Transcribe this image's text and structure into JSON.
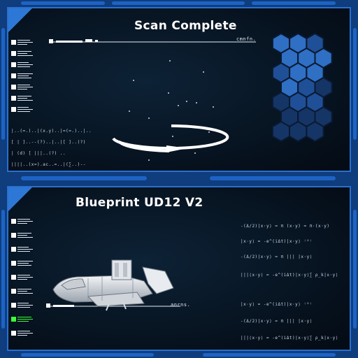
{
  "colors": {
    "frame": "#0f3d7d",
    "frame_bar": "#1e63c4",
    "panel_border": "#2a6fcc",
    "hex_bright": "#2f6fc4",
    "hex_mid": "#1f4f96",
    "hex_dim": "#153566",
    "active_item": "#3bff3b"
  },
  "scan_panel": {
    "title": "Scan Complete",
    "scale_label": "cmnfn.",
    "sidebar_items": 10,
    "formulas": [
      "|..(=.)..|(x.y)..|=(=.)..|..",
      "[ | ]..--(?)..|..|[ ]..(?)",
      "| (d) [ |||..(?) ..",
      "||||..(x=).ac..=..|(∑..)--"
    ],
    "icons": [
      "scan-ring-icon",
      "star-field"
    ]
  },
  "blueprint_panel": {
    "title": "Blueprint UD12 V2",
    "scale_label": "anrns.",
    "active_item_index": 8,
    "formulas": [
      "-(Δ/2)|x·y⟩ = π (x·y) = π·(x·y)",
      "|x·y⟩ = -e^(iΔt)|x·y⟩ ⁽⁰⁾",
      "-(Δ/2)|x·y⟩ = π ||| |x·y⟩",
      "|||⟨x·y⟩ = -e^(iΔt)|x·y⟩∑ ρ_k|x·y⟩",
      "|x·y⟩ = -e^(iΔt)|x·y⟩ ⁽⁰⁾",
      "-(Δ/2)|x·y⟩ = π |||  |x·y⟩",
      "|||⟨x·y⟩ = -e^(iΔt)|x·y⟩∑ ρ_k|x·y⟩"
    ],
    "icons": [
      "spaceship-icon"
    ]
  }
}
